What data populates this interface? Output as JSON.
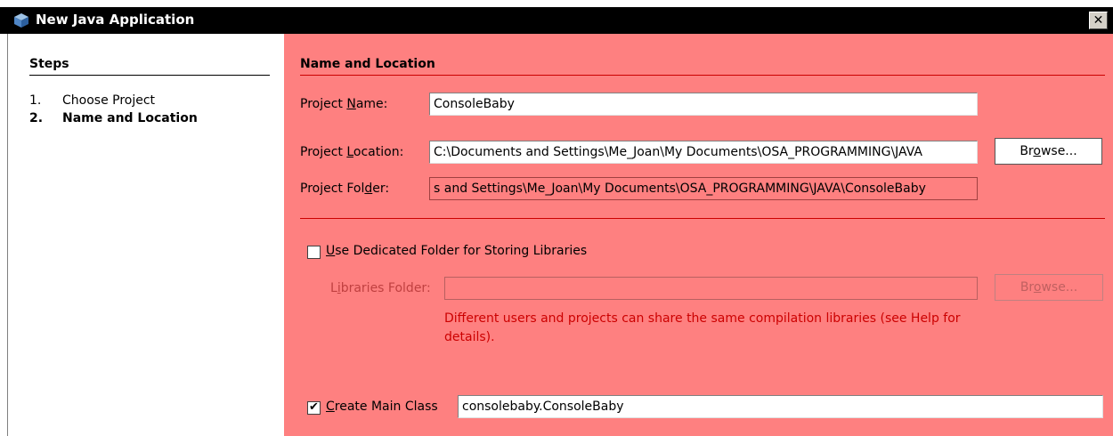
{
  "window": {
    "title": "New Java Application",
    "close_glyph": "✕"
  },
  "steps": {
    "heading": "Steps",
    "items": [
      {
        "num": "1.",
        "label": "Choose Project"
      },
      {
        "num": "2.",
        "label": "Name and Location"
      }
    ]
  },
  "panel": {
    "heading": "Name and Location",
    "project_name": {
      "label_pre": "Project ",
      "label_mn": "N",
      "label_post": "ame:",
      "value": "ConsoleBaby"
    },
    "project_location": {
      "label_pre": "Project ",
      "label_mn": "L",
      "label_post": "ocation:",
      "value": "C:\\Documents and Settings\\Me_Joan\\My Documents\\OSA_PROGRAMMING\\JAVA",
      "browse_pre": "Br",
      "browse_mn": "o",
      "browse_post": "wse..."
    },
    "project_folder": {
      "label_pre": "Project Fol",
      "label_mn": "d",
      "label_post": "er:",
      "value": "s and Settings\\Me_Joan\\My Documents\\OSA_PROGRAMMING\\JAVA\\ConsoleBaby"
    },
    "dedicated_folder": {
      "label_mn": "U",
      "label_post": "se Dedicated Folder for Storing Libraries",
      "checked": false
    },
    "libraries_folder": {
      "label_pre": "L",
      "label_mn": "i",
      "label_post": "braries Folder:",
      "value": "",
      "browse_pre": "Br",
      "browse_mn": "o",
      "browse_post": "wse..."
    },
    "libraries_hint": "Different users and projects can share the same compilation libraries (see Help for details).",
    "create_main_class": {
      "label_mn": "C",
      "label_post": "reate Main Class",
      "checked": true,
      "value": "consolebaby.ConsoleBaby"
    }
  },
  "colors": {
    "panel_bg": "#fe8080",
    "titlebar_bg": "#000000",
    "hint_text": "#cc0000"
  }
}
